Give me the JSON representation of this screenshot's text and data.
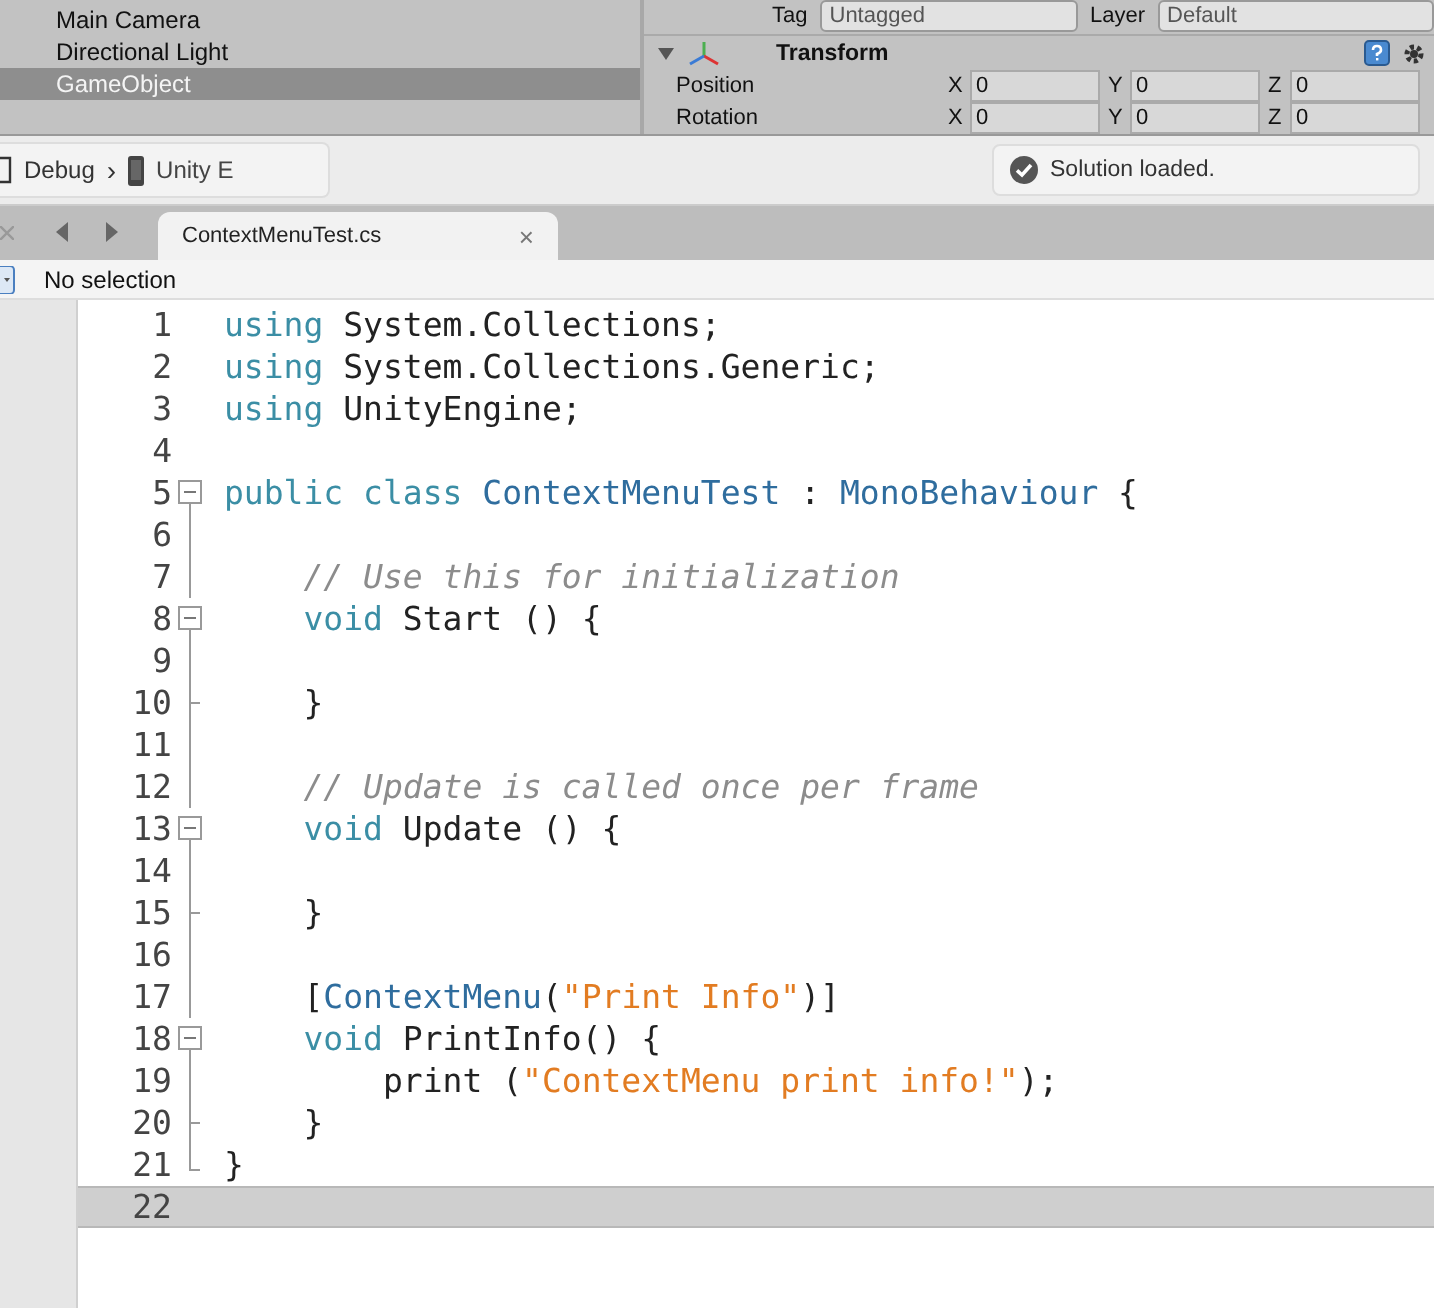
{
  "hierarchy": {
    "items": [
      {
        "label": "Main Camera",
        "selected": false
      },
      {
        "label": "Directional Light",
        "selected": false
      },
      {
        "label": "GameObject",
        "selected": true
      }
    ]
  },
  "inspector": {
    "tag_label": "Tag",
    "tag_value": "Untagged",
    "layer_label": "Layer",
    "layer_value": "Default",
    "component": {
      "title": "Transform",
      "expanded": true,
      "rows": [
        {
          "label": "Position",
          "fields": [
            {
              "axis": "X",
              "value": "0"
            },
            {
              "axis": "Y",
              "value": "0"
            },
            {
              "axis": "Z",
              "value": "0"
            }
          ]
        },
        {
          "label": "Rotation",
          "fields": [
            {
              "axis": "X",
              "value": "0"
            },
            {
              "axis": "Y",
              "value": "0"
            },
            {
              "axis": "Z",
              "value": "0"
            }
          ]
        }
      ]
    }
  },
  "toolbar": {
    "configuration": "Debug",
    "separator": "›",
    "target": "Unity E",
    "status": "Solution loaded."
  },
  "tabs": [
    {
      "label": "ContextMenuTest.cs",
      "selected": true,
      "close": "×"
    }
  ],
  "breadcrumb": "No selection",
  "editor": {
    "lines": [
      {
        "number": "1",
        "kind": "plain",
        "current": false,
        "tokens": [
          {
            "kind": "keyword",
            "text": "using"
          },
          {
            "kind": "plain",
            "text": " System.Collections;"
          }
        ]
      },
      {
        "number": "2",
        "kind": "plain",
        "current": false,
        "tokens": [
          {
            "kind": "keyword",
            "text": "using"
          },
          {
            "kind": "plain",
            "text": " System.Collections.Generic;"
          }
        ]
      },
      {
        "number": "3",
        "kind": "plain",
        "current": false,
        "tokens": [
          {
            "kind": "keyword",
            "text": "using"
          },
          {
            "kind": "plain",
            "text": " UnityEngine;"
          }
        ]
      },
      {
        "number": "4",
        "kind": "plain",
        "current": false
      },
      {
        "number": "5",
        "kind": "fold-start",
        "current": false,
        "tokens": [
          {
            "kind": "keyword",
            "text": "public class"
          },
          {
            "kind": "type",
            "text": " ContextMenuTest"
          },
          {
            "kind": "plain",
            "text": " : "
          },
          {
            "kind": "type",
            "text": "MonoBehaviour"
          },
          {
            "kind": "plain",
            "text": " {"
          }
        ]
      },
      {
        "number": "6",
        "kind": "fold-line",
        "current": false
      },
      {
        "number": "7",
        "kind": "fold-line",
        "current": false,
        "tokens": [
          {
            "kind": "comment",
            "text": "    // Use this for initialization"
          }
        ]
      },
      {
        "number": "8",
        "kind": "fold-start",
        "current": false,
        "tokens": [
          {
            "kind": "keyword",
            "text": "    void"
          },
          {
            "kind": "plain",
            "text": " Start () {"
          }
        ]
      },
      {
        "number": "9",
        "kind": "fold-line",
        "current": false
      },
      {
        "number": "10",
        "kind": "fold-end",
        "current": false,
        "tokens": [
          {
            "kind": "plain",
            "text": "    }"
          }
        ]
      },
      {
        "number": "11",
        "kind": "fold-line",
        "current": false
      },
      {
        "number": "12",
        "kind": "fold-line",
        "current": false,
        "tokens": [
          {
            "kind": "comment",
            "text": "    // Update is called once per frame"
          }
        ]
      },
      {
        "number": "13",
        "kind": "fold-start",
        "current": false,
        "tokens": [
          {
            "kind": "keyword",
            "text": "    void"
          },
          {
            "kind": "plain",
            "text": " Update () {"
          }
        ]
      },
      {
        "number": "14",
        "kind": "fold-line",
        "current": false
      },
      {
        "number": "15",
        "kind": "fold-end",
        "current": false,
        "tokens": [
          {
            "kind": "plain",
            "text": "    }"
          }
        ]
      },
      {
        "number": "16",
        "kind": "fold-line",
        "current": false
      },
      {
        "number": "17",
        "kind": "fold-line",
        "current": false,
        "tokens": [
          {
            "kind": "plain",
            "text": "    ["
          },
          {
            "kind": "type",
            "text": "ContextMenu"
          },
          {
            "kind": "plain",
            "text": "("
          },
          {
            "kind": "string",
            "text": "\"Print Info\""
          },
          {
            "kind": "plain",
            "text": ")]"
          }
        ]
      },
      {
        "number": "18",
        "kind": "fold-start",
        "current": false,
        "tokens": [
          {
            "kind": "keyword",
            "text": "    void"
          },
          {
            "kind": "plain",
            "text": " PrintInfo() {"
          }
        ]
      },
      {
        "number": "19",
        "kind": "fold-line",
        "current": false,
        "tokens": [
          {
            "kind": "plain",
            "text": "        print ("
          },
          {
            "kind": "string",
            "text": "\"ContextMenu print info!\""
          },
          {
            "kind": "plain",
            "text": ");"
          }
        ]
      },
      {
        "number": "20",
        "kind": "fold-end",
        "current": false,
        "tokens": [
          {
            "kind": "plain",
            "text": "    }"
          }
        ]
      },
      {
        "number": "21",
        "kind": "fold-close",
        "current": false,
        "tokens": [
          {
            "kind": "plain",
            "text": "}"
          }
        ]
      },
      {
        "number": "22",
        "kind": "plain",
        "current": true
      }
    ]
  }
}
